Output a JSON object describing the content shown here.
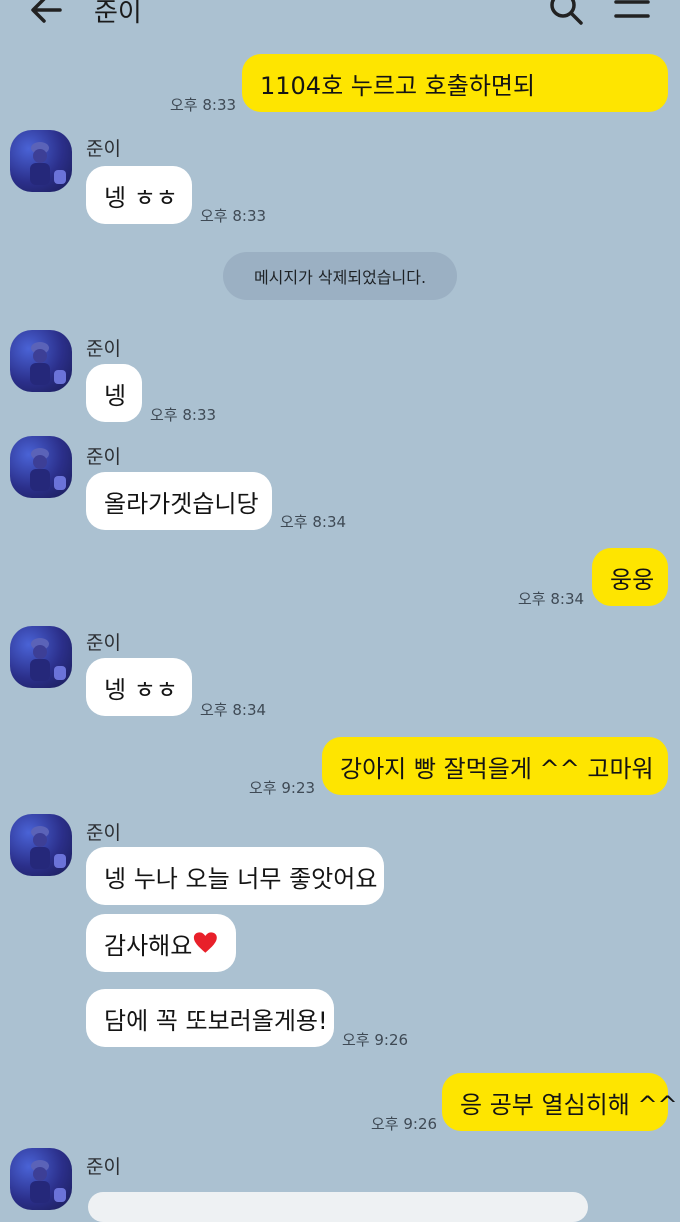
{
  "header": {
    "title": "준이"
  },
  "system_message": "메시지가 삭제되었습니다.",
  "messages": [
    {
      "text": "1104호 누르고 호출하면되",
      "time": "오후 8:33"
    },
    {
      "sender": "준이",
      "text": "넹 ㅎㅎ",
      "time": "오후 8:33"
    },
    {
      "sender": "준이",
      "text": "넹",
      "time": "오후 8:33"
    },
    {
      "sender": "준이",
      "text": "올라가겟습니당",
      "time": "오후 8:34"
    },
    {
      "text": "웅웅",
      "time": "오후 8:34"
    },
    {
      "sender": "준이",
      "text": "넹 ㅎㅎ",
      "time": "오후 8:34"
    },
    {
      "text": "강아지 빵 잘먹을게 ^^ 고마워",
      "emoji": "❤️",
      "time": "오후 9:23"
    },
    {
      "sender": "준이",
      "text": "넹 누나 오늘 너무 좋앗어요"
    },
    {
      "text": "감사해요",
      "emoji": "❤️"
    },
    {
      "text": "담에 꼭 또보러올게용!",
      "time": "오후 9:26"
    },
    {
      "text": "응 공부 열심히해 ^^",
      "time": "오후 9:26"
    },
    {
      "sender": "준이"
    }
  ],
  "icons": {
    "back": "back-arrow-icon",
    "search": "search-icon",
    "menu": "menu-icon",
    "heart": "heart-icon"
  },
  "colors": {
    "background": "#abc1d1",
    "my_bubble": "#fee500",
    "their_bubble": "#ffffff"
  }
}
